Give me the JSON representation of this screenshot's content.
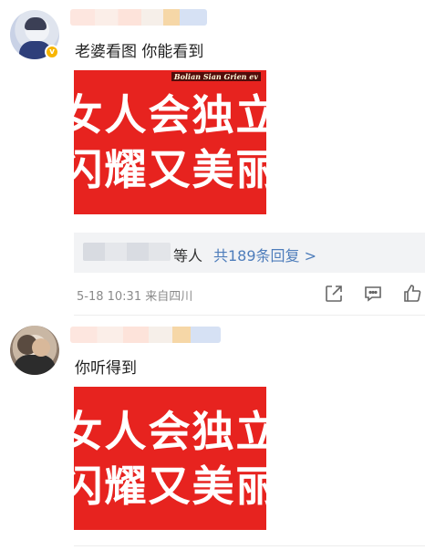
{
  "comments": [
    {
      "text": "老婆看图 你能看到",
      "meme": {
        "line1": "女人会独立",
        "line2": "闪耀又美丽",
        "watermark": "Bolian Sian Grien ev"
      },
      "replies": {
        "suffix": "等人",
        "link": "共189条回复 >"
      },
      "meta": "5-18 10:31 来自四川"
    },
    {
      "text": "你听得到",
      "meme": {
        "line1": "女人会独立",
        "line2": "闪耀又美丽"
      }
    }
  ],
  "colors": {
    "meme_red": "#e7231f",
    "link_blue": "#4e7dbb",
    "verified_gold": "#f7b500"
  },
  "icons": [
    "share-icon",
    "comment-icon",
    "like-icon",
    "verified-badge-icon"
  ]
}
